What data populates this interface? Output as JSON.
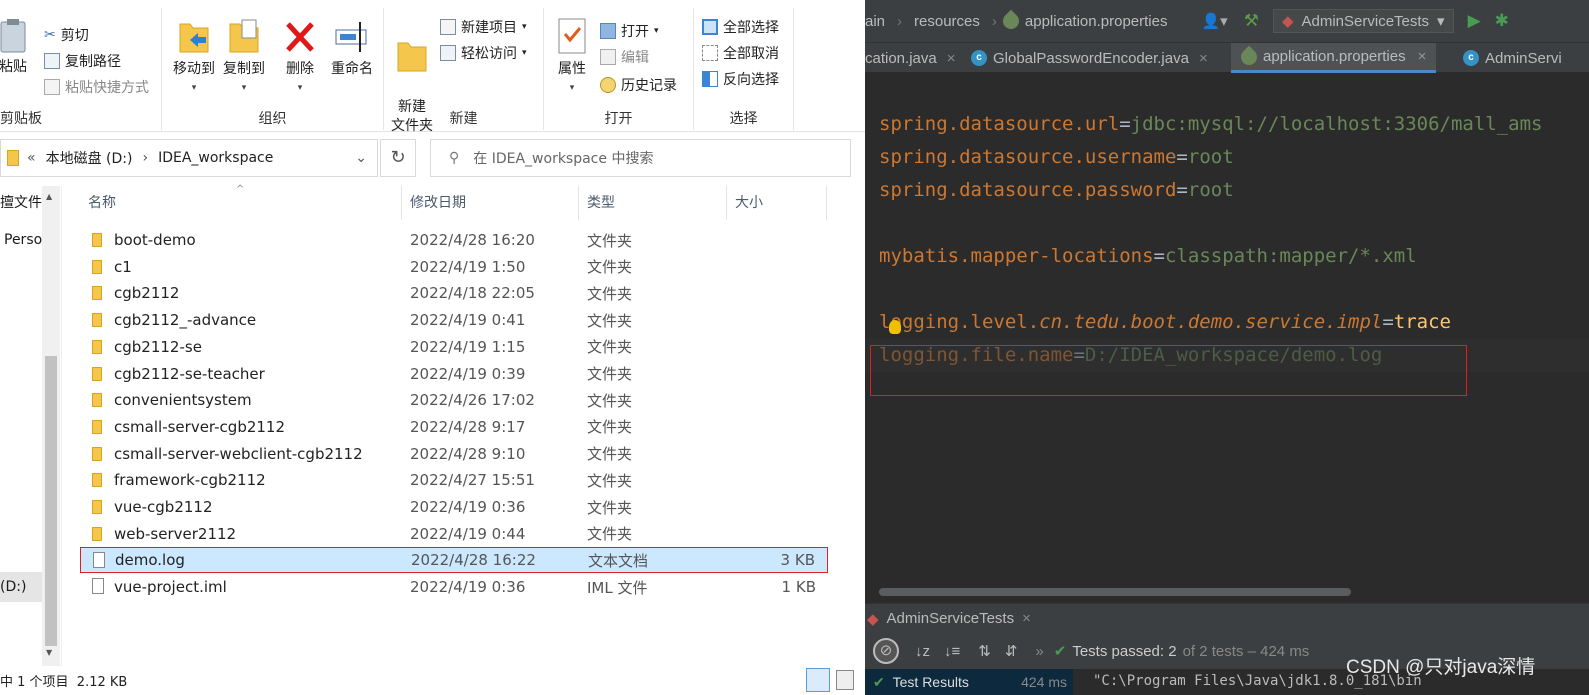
{
  "ribbon": {
    "clipboard": {
      "paste": "粘贴",
      "cut": "剪切",
      "copy_path": "复制路径",
      "paste_shortcut": "粘贴快捷方式",
      "group_label": "剪贴板"
    },
    "organize": {
      "move_to": "移动到",
      "copy_to": "复制到",
      "delete": "删除",
      "rename": "重命名",
      "group_label": "组织"
    },
    "new": {
      "new_folder": "新建\n文件夹",
      "new_item": "新建项目",
      "easy_access": "轻松访问",
      "group_label": "新建"
    },
    "open": {
      "properties": "属性",
      "open": "打开",
      "edit": "编辑",
      "history": "历史记录",
      "group_label": "打开"
    },
    "select": {
      "select_all": "全部选择",
      "select_none": "全部取消",
      "invert": "反向选择",
      "group_label": "选择"
    }
  },
  "address": {
    "overflow": "«",
    "drive": "本地磁盘 (D:)",
    "folder": "IDEA_workspace",
    "search_placeholder": "在 IDEA_workspace 中搜索"
  },
  "navpane": {
    "item1": "擅文件",
    "item2": "Perso",
    "item3": "(D:)"
  },
  "columns": {
    "name": "名称",
    "date": "修改日期",
    "type": "类型",
    "size": "大小"
  },
  "files": [
    {
      "name": "boot-demo",
      "date": "2022/4/28 16:20",
      "type": "文件夹",
      "size": "",
      "kind": "folder"
    },
    {
      "name": "c1",
      "date": "2022/4/19 1:50",
      "type": "文件夹",
      "size": "",
      "kind": "folder"
    },
    {
      "name": "cgb2112",
      "date": "2022/4/18 22:05",
      "type": "文件夹",
      "size": "",
      "kind": "folder"
    },
    {
      "name": "cgb2112_-advance",
      "date": "2022/4/19 0:41",
      "type": "文件夹",
      "size": "",
      "kind": "folder"
    },
    {
      "name": "cgb2112-se",
      "date": "2022/4/19 1:15",
      "type": "文件夹",
      "size": "",
      "kind": "folder"
    },
    {
      "name": "cgb2112-se-teacher",
      "date": "2022/4/19 0:39",
      "type": "文件夹",
      "size": "",
      "kind": "folder"
    },
    {
      "name": "convenientsystem",
      "date": "2022/4/26 17:02",
      "type": "文件夹",
      "size": "",
      "kind": "folder"
    },
    {
      "name": "csmall-server-cgb2112",
      "date": "2022/4/28 9:17",
      "type": "文件夹",
      "size": "",
      "kind": "folder"
    },
    {
      "name": "csmall-server-webclient-cgb2112",
      "date": "2022/4/28 9:10",
      "type": "文件夹",
      "size": "",
      "kind": "folder"
    },
    {
      "name": "framework-cgb2112",
      "date": "2022/4/27 15:51",
      "type": "文件夹",
      "size": "",
      "kind": "folder"
    },
    {
      "name": "vue-cgb2112",
      "date": "2022/4/19 0:36",
      "type": "文件夹",
      "size": "",
      "kind": "folder"
    },
    {
      "name": "web-server2112",
      "date": "2022/4/19 0:44",
      "type": "文件夹",
      "size": "",
      "kind": "folder"
    },
    {
      "name": "demo.log",
      "date": "2022/4/28 16:22",
      "type": "文本文档",
      "size": "3 KB",
      "kind": "file",
      "selected": true
    },
    {
      "name": "vue-project.iml",
      "date": "2022/4/19 0:36",
      "type": "IML 文件",
      "size": "1 KB",
      "kind": "file"
    }
  ],
  "status": {
    "text": "中 1 个项目  2.12 KB"
  },
  "ide": {
    "breadcrumb": {
      "part1": "ain",
      "part2": "resources",
      "part3": "application.properties"
    },
    "run_config": "AdminServiceTests",
    "tabs": [
      {
        "label": "cation.java",
        "icon": "class-icon"
      },
      {
        "label": "GlobalPasswordEncoder.java",
        "icon": "class-icon"
      },
      {
        "label": "application.properties",
        "icon": "spring-leaf-icon",
        "active": true
      },
      {
        "label": "AdminServi",
        "icon": "class-icon"
      }
    ],
    "code": {
      "l1k": "spring.datasource.url",
      "l1v": "jdbc:mysql://localhost:3306/mall_ams",
      "l2k": "spring.datasource.username",
      "l2v": "root",
      "l3k": "spring.datasource.password",
      "l3v": "root",
      "l4k": "mybatis.mapper-locations",
      "l4v": "classpath:mapper/*.xml",
      "l5k": "logging.level.",
      "l5ki": "cn.tedu.boot.demo.service.impl",
      "l5v": "trace",
      "l6k": "logging.file.name",
      "l6v": "D:/IDEA_workspace/demo.log",
      "eq": "="
    },
    "run_tab": "AdminServiceTests",
    "tests_passed": "Tests passed: 2",
    "tests_detail": "of 2 tests – 424 ms",
    "test_results": "Test Results",
    "test_time": "424 ms",
    "console": "\"C:\\Program Files\\Java\\jdk1.8.0_181\\bin"
  },
  "watermark": "CSDN @只对java深情",
  "colors": {
    "selection": "#cce8ff",
    "highlight_border": "#e02020",
    "ide_bg": "#2b2b2b",
    "key": "#cc7832",
    "value": "#6a8759"
  }
}
